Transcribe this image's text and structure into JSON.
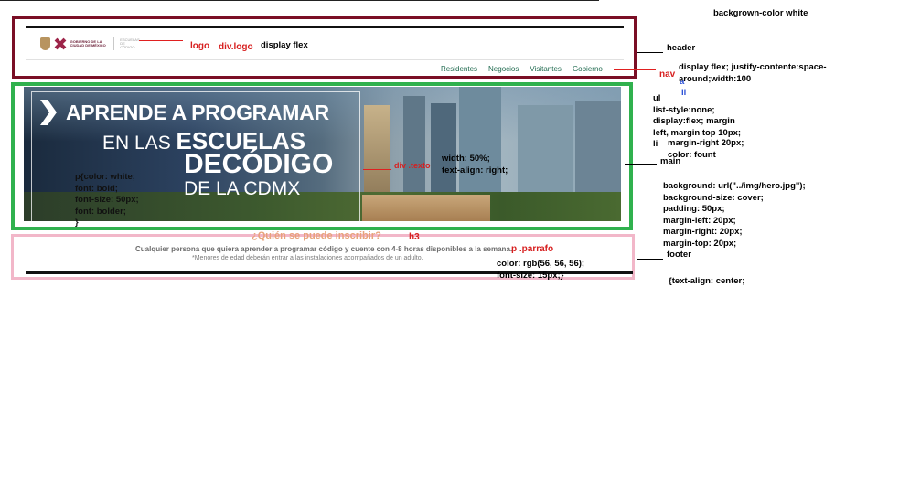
{
  "header": {
    "logo_text": "GOBIERNO DE LA CIUDAD DE MÉXICO",
    "logo_sub": "ESCUELAS DE CÓDIGO",
    "nav": [
      "Residentes",
      "Negocios",
      "Visitantes",
      "Gobierno"
    ]
  },
  "hero": {
    "line1": "APRENDE A PROGRAMAR",
    "line2_light": "EN LAS ",
    "line2_bold": "ESCUELAS",
    "line3": "DECÓDIGO",
    "line4": "DE LA CDMX"
  },
  "footer": {
    "h3": "¿Quién se puede inscribir?",
    "parrafo": "Cualquier persona que quiera aprender a programar código y cuente con 4-8 horas disponibles a la semana.",
    "nota": "*Menores de edad deberán entrar a las instalaciones acompañados de un adulto."
  },
  "annotations": {
    "background": "backgrown-color white",
    "logo": "logo",
    "div_logo": "div.logo",
    "display_flex": "display flex",
    "header": "header",
    "nav": "nav",
    "nav_css": "display flex; justify-contente:space-\naround;width:100",
    "a": "a",
    "li_1": "li",
    "ul_css": "ul\nlist-style:none;\ndisplay:flex; margin\nleft, margin top 10px;\nli",
    "li_css": "margin-right 20px;\ncolor: fount",
    "main": "main",
    "div_texto": "div .texto",
    "texto_css": "width: 50%;\ntext-align: right;",
    "p_css": "p{color: white;\nfont: bold;\nfont-size: 50px;\nfont: bolder;\n}",
    "main_css": "background: url(\"../img/hero.jpg\");\nbackground-size: cover;\npadding: 50px;\nmargin-left: 20px;\nmargin-right: 20px;\nmargin-top: 20px;",
    "h3": "h3",
    "p_parrafo": "p .parrafo",
    "parrafo_css": "color: rgb(56, 56, 56);\nfont-size: 15px;}",
    "footer": "footer",
    "text_align": "{text-align: center;"
  }
}
